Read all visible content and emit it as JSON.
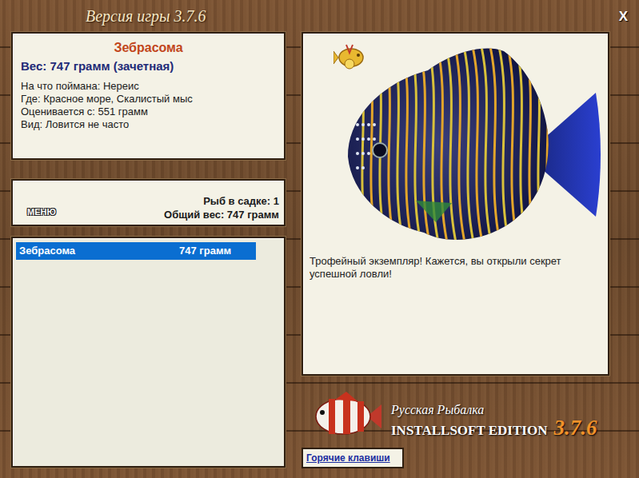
{
  "window": {
    "title": "Версия игры 3.7.6",
    "close": "X"
  },
  "fish": {
    "name": "Зебрасома",
    "weight": "Вес: 747 грамм (зачетная)",
    "details": [
      "На что поймана: Нереис",
      "Где: Красное море, Скалистый мыс",
      "Оценивается с: 551 грамм",
      "Вид: Ловится не часто"
    ]
  },
  "keepnet": {
    "count": "Рыб в садке: 1",
    "total": "Общий вес: 747 грамм"
  },
  "menu_button": "МЕНЮ",
  "catch_list": [
    {
      "name": "Зебрасома",
      "weight": "747 грамм",
      "selected": true
    }
  ],
  "message": "Трофейный экземпляр! Кажется, вы открыли секрет успешной ловли!",
  "logo": {
    "line1": "Русская Рыбалка",
    "line2": "INSTALLSOFT EDITION",
    "version": "3.7.6"
  },
  "hotkeys_button": "Горячие клавиши"
}
